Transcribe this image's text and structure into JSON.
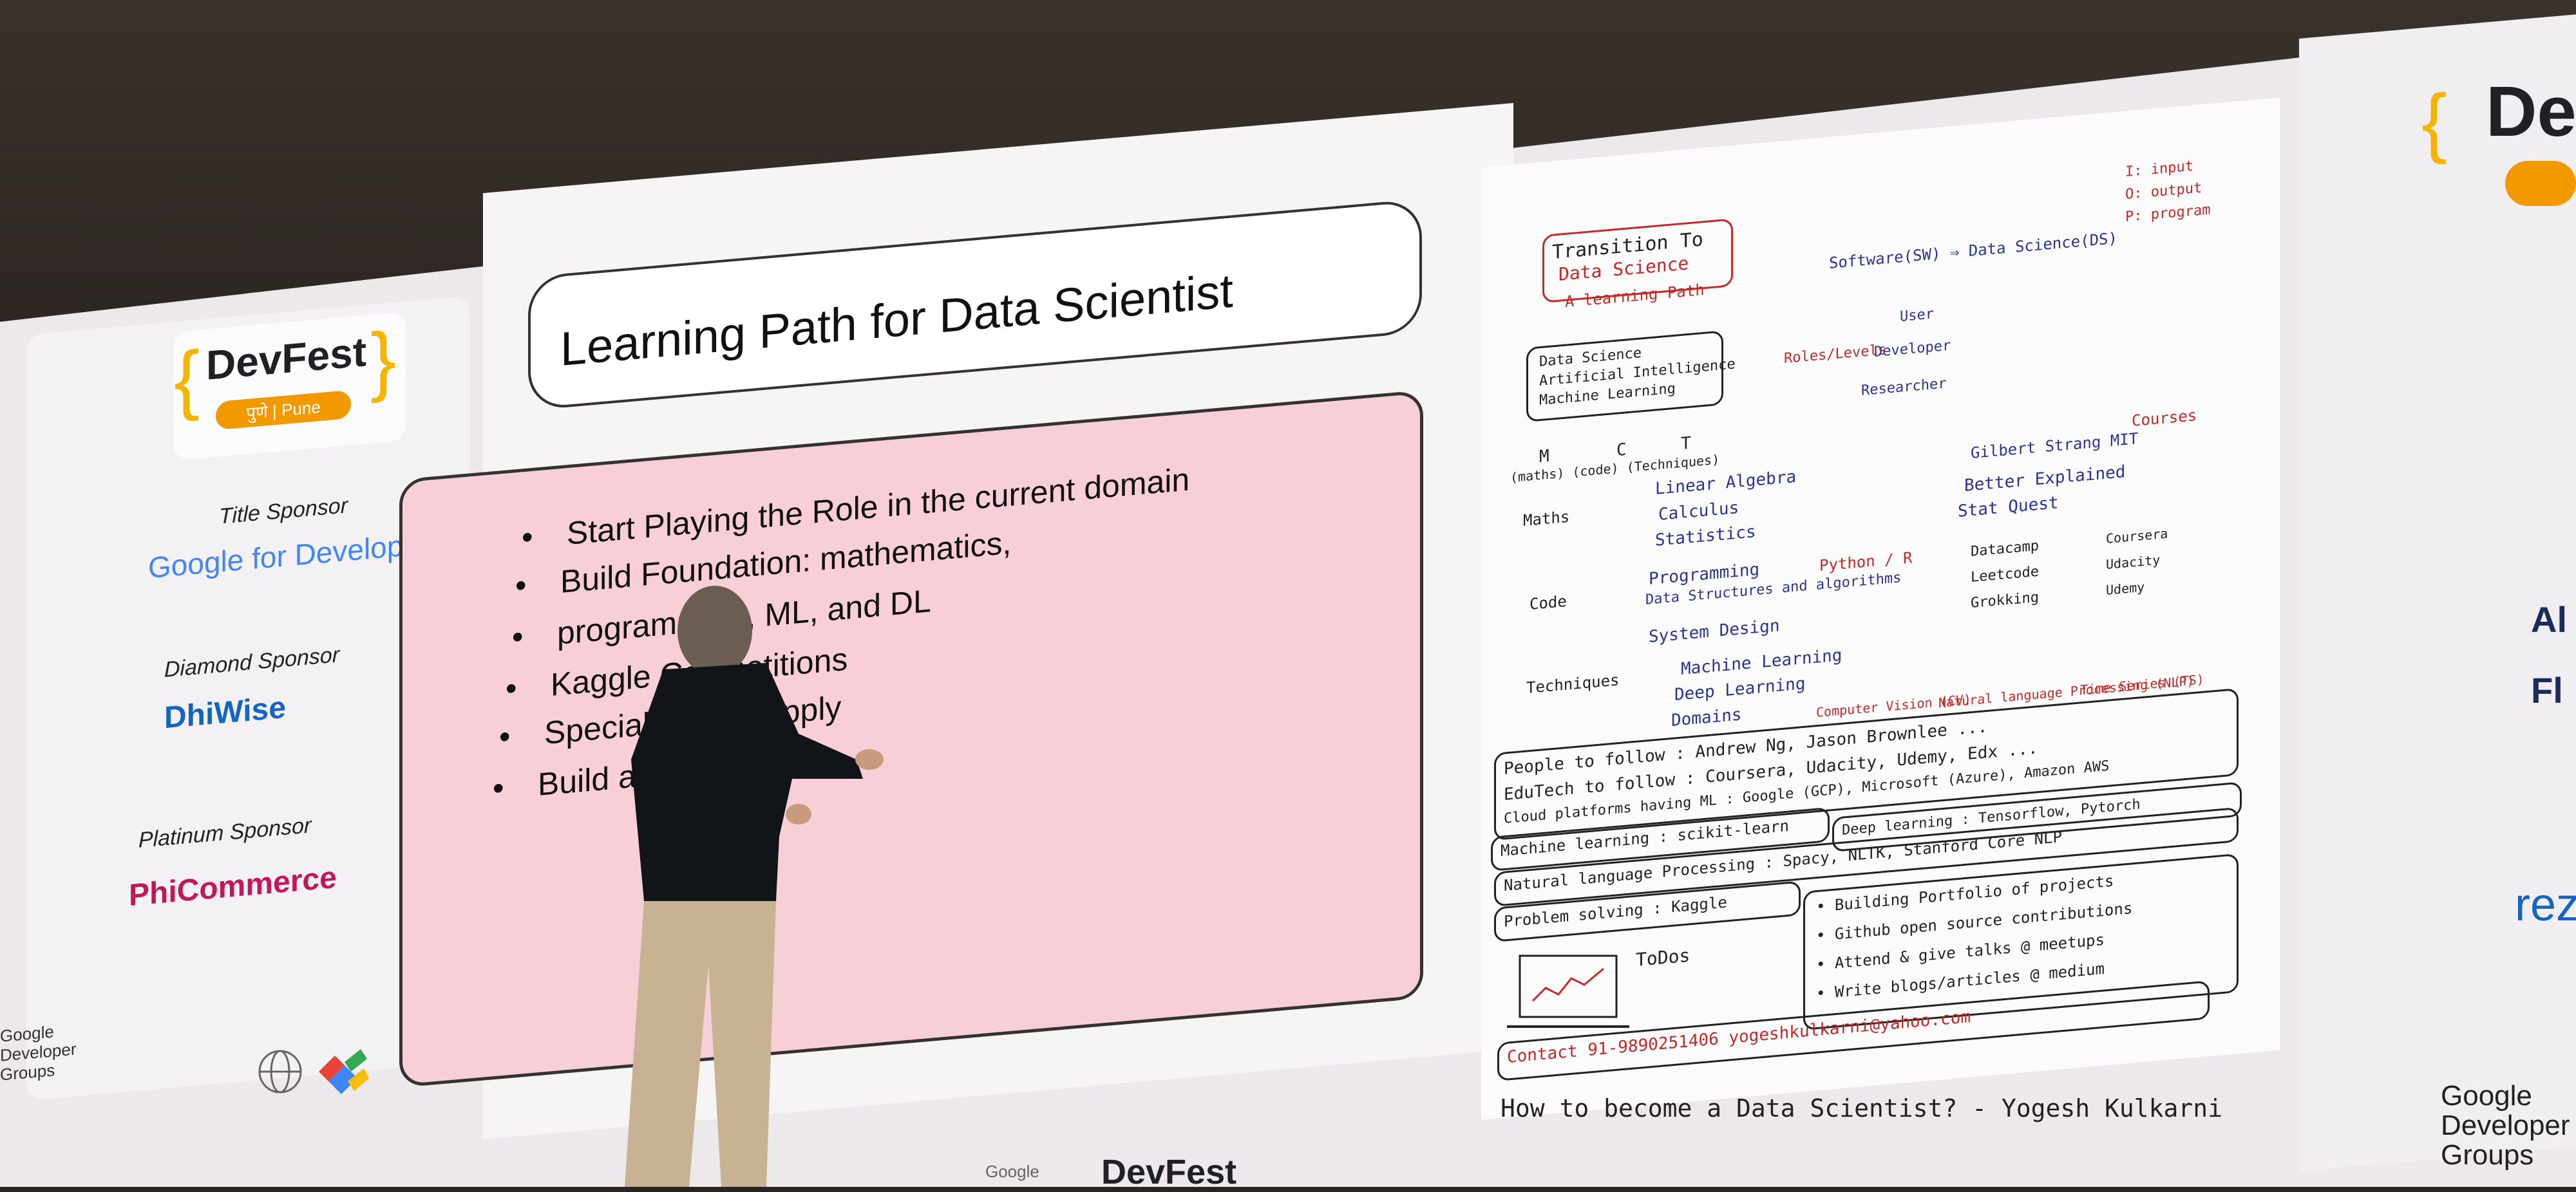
{
  "sponsor_panel": {
    "event_name": "DevFest",
    "event_sub": "पुणे | Pune",
    "title_sponsor_label": "Title Sponsor",
    "title_sponsor_name": "Google for Developers",
    "diamond_sponsor_label": "Diamond Sponsor",
    "diamond_sponsor_name": "DhiWise",
    "platinum_sponsor_label": "Platinum Sponsor",
    "platinum_sponsor_name": "PhiCommerce",
    "gdg_label": "Google Developer Groups"
  },
  "slide": {
    "title": "Learning Path for Data Scientist",
    "bullets": [
      "Start Playing the Role in the current domain",
      "Build Foundation:  mathematics,",
      "programming, ML, and DL",
      "Kaggle Competitions",
      "Specialize and Apply",
      "Build a Portfolio"
    ]
  },
  "sketch": {
    "banner_line1": "Transition To",
    "banner_line2": "Data Science",
    "banner_sub": "A learning Path",
    "top_right_1": "I: input",
    "top_right_2": "O: output",
    "top_right_3": "P: program",
    "sw_to_ds": "Software(SW) ⇒ Data Science(DS)",
    "pillars_1": "Data Science",
    "pillars_2": "Artificial Intelligence",
    "pillars_3": "Machine Learning",
    "pillar_m": "M",
    "pillar_c": "C",
    "pillar_t": "T",
    "pillar_labels": "(maths) (code) (Techniques)",
    "roles_label": "Roles/Levels",
    "role_user": "User",
    "role_developer": "Developer",
    "role_researcher": "Researcher",
    "courses": "Courses",
    "maths_label": "Maths",
    "maths_1": "Linear Algebra",
    "maths_2": "Calculus",
    "maths_3": "Statistics",
    "maths_r1": "Gilbert Strang MIT",
    "maths_r2": "Better Explained",
    "maths_r3": "Stat Quest",
    "code_label": "Code",
    "code_1": "Programming",
    "code_2": "Data Structures and algorithms",
    "code_3": "System Design",
    "code_mid": "Python / R",
    "code_r1": "Datacamp",
    "code_r2": "Leetcode",
    "code_r3": "Grokking",
    "code_r4": "Coursera",
    "code_r5": "Udacity",
    "code_r6": "Udemy",
    "tech_label": "Techniques",
    "tech_1": "Machine Learning",
    "tech_2": "Deep Learning",
    "tech_3": "Domains",
    "tech_d1": "Computer Vision (CV)",
    "tech_d2": "Natural language Processing (NLP)",
    "tech_d3": "Time Series (TS)",
    "list_1": "People to follow : Andrew Ng, Jason Brownlee ...",
    "list_2": "EduTech to follow : Coursera, Udacity, Udemy, Edx ...",
    "list_3": "Cloud platforms having ML : Google (GCP), Microsoft (Azure), Amazon AWS",
    "list_4a": "Machine learning : scikit-learn",
    "list_4b": "Deep learning : Tensorflow, Pytorch",
    "list_5": "Natural language Processing : Spacy, NLTK, Stanford Core NLP",
    "list_6": "Problem solving : Kaggle",
    "todos": "ToDos",
    "todo_1": "• Building Portfolio of projects",
    "todo_2": "• Github open source contributions",
    "todo_3": "• Attend & give talks @ meetups",
    "todo_4": "• Write blogs/articles @ medium",
    "contact": "Contact  91-9890251406  yogeshkulkarni@yahoo.com",
    "caption": "How to become a Data Scientist? - Yogesh Kulkarni"
  },
  "right_panel": {
    "brand_partial": "De",
    "sponsor_a": "Al",
    "sponsor_f": "Fl",
    "sponsor_rez": "rez",
    "gdg_label": "Google Developer Groups"
  },
  "bottom_bar": {
    "event_name": "DevFest",
    "google_label": "Google"
  },
  "colors": {
    "accent_orange": "#f29900",
    "slide_pink": "#f8cfd7",
    "sketch_red": "#c62828",
    "sketch_blue": "#283593"
  }
}
